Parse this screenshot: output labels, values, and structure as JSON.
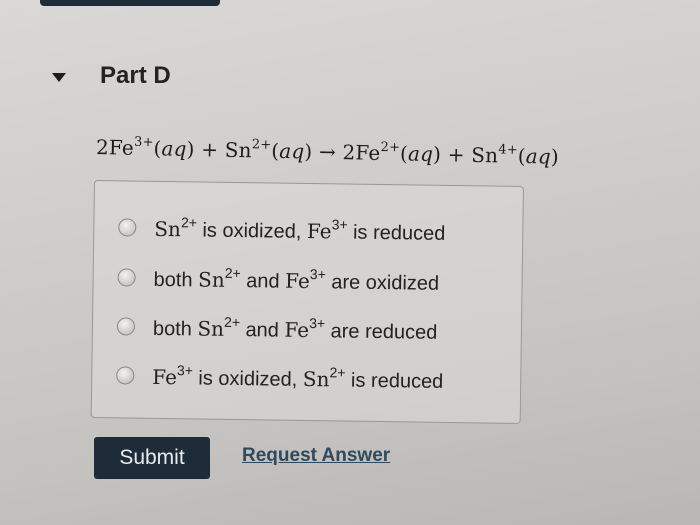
{
  "part": {
    "title": "Part D"
  },
  "equation": {
    "t1": "2Fe",
    "s1": "3+",
    "t2": "(",
    "aq": "aq",
    "t3": ") + Sn",
    "s2": "2+",
    "t4": "(",
    "t5": ") → 2Fe",
    "s3": "2+",
    "t6": "(",
    "t7": ") + Sn",
    "s4": "4+",
    "t8": "(",
    "t9": ")"
  },
  "options": [
    {
      "parts": [
        "",
        "Sn",
        "2+",
        " is oxidized, ",
        "Fe",
        "3+",
        " is reduced"
      ]
    },
    {
      "parts": [
        "both ",
        "Sn",
        "2+",
        " and ",
        "Fe",
        "3+",
        " are oxidized"
      ]
    },
    {
      "parts": [
        "both ",
        "Sn",
        "2+",
        " and ",
        "Fe",
        "3+",
        " are reduced"
      ]
    },
    {
      "parts": [
        "",
        "Fe",
        "3+",
        " is oxidized, ",
        "Sn",
        "2+",
        " is reduced"
      ]
    }
  ],
  "actions": {
    "submit_label": "Submit",
    "request_answer_label": "Request Answer"
  }
}
